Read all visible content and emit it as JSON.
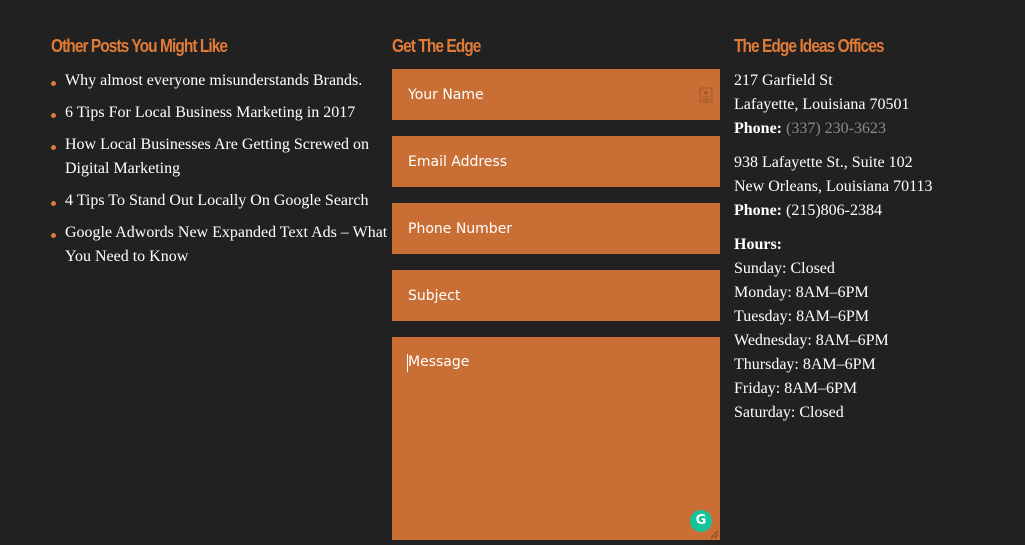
{
  "posts": {
    "heading": "Other Posts You Might Like",
    "items": [
      "Why almost everyone misunderstands Brands.",
      "6 Tips For Local Business Marketing in 2017",
      "How Local Businesses Are Getting Screwed on Digital Marketing",
      "4 Tips To Stand Out Locally On Google Search",
      "Google Adwords New Expanded Text Ads – What You Need to Know"
    ]
  },
  "form": {
    "heading": "Get The Edge",
    "name_placeholder": "Your Name",
    "email_placeholder": "Email Address",
    "phone_placeholder": "Phone Number",
    "subject_placeholder": "Subject",
    "message_placeholder": "Message",
    "autofill_icon": "contact-card-icon",
    "grammarly_icon": "grammarly-icon",
    "grammarly_glyph": "G"
  },
  "offices": {
    "heading": "The Edge Ideas Offices",
    "office1": {
      "street": "217 Garfield St",
      "city": "Lafayette, Louisiana 70501",
      "phone_label": "Phone:",
      "phone": "(337) 230-3623"
    },
    "office2": {
      "street": "938 Lafayette St., Suite 102",
      "city": "New Orleans, Louisiana 70113",
      "phone_label": "Phone:",
      "phone": "(215)806-2384"
    },
    "hours": {
      "label": "Hours:",
      "days": [
        "Sunday: Closed",
        "Monday: 8AM–6PM",
        "Tuesday: 8AM–6PM",
        "Wednesday: 8AM–6PM",
        "Thursday: 8AM–6PM",
        "Friday: 8AM–6PM",
        "Saturday: Closed"
      ]
    }
  },
  "colors": {
    "background": "#222122",
    "accent": "#e07b37",
    "field": "#c96f35",
    "grammarly": "#15c39a"
  }
}
